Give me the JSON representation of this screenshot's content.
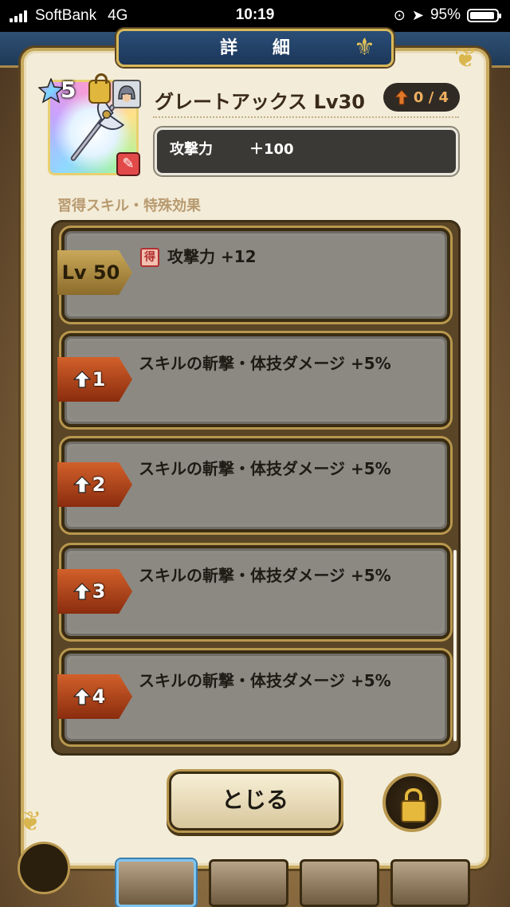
{
  "status_bar": {
    "carrier": "SoftBank",
    "network": "4G",
    "time": "10:19",
    "battery": "95%",
    "icons": [
      "signal-bars-icon",
      "rotation-lock-icon",
      "location-arrow-icon",
      "battery-icon"
    ]
  },
  "header": {
    "title": "詳 細"
  },
  "item": {
    "rarity": "5",
    "name": "グレートアックス Lv30",
    "upgrade": "0 / 4",
    "stat_label": "攻撃力",
    "stat_value": "＋100"
  },
  "skills_section": {
    "title": "習得スキル・特殊効果",
    "rows": [
      {
        "tag": "Lv 50",
        "badge": "得",
        "text": "攻撃力 +12"
      },
      {
        "tag": "1",
        "text": "スキルの斬撃・体技ダメージ +5%"
      },
      {
        "tag": "2",
        "text": "スキルの斬撃・体技ダメージ +5%"
      },
      {
        "tag": "3",
        "text": "スキルの斬撃・体技ダメージ +5%"
      },
      {
        "tag": "4",
        "text": "スキルの斬撃・体技ダメージ +5%"
      }
    ]
  },
  "footer": {
    "close_label": "とじる"
  },
  "colors": {
    "panel": "#f3ecd8",
    "gold_border": "#c8aa5e",
    "title_blue": "#1c3658",
    "row_gray": "#8f8c85",
    "upgrade_orange": "#d2602a"
  }
}
